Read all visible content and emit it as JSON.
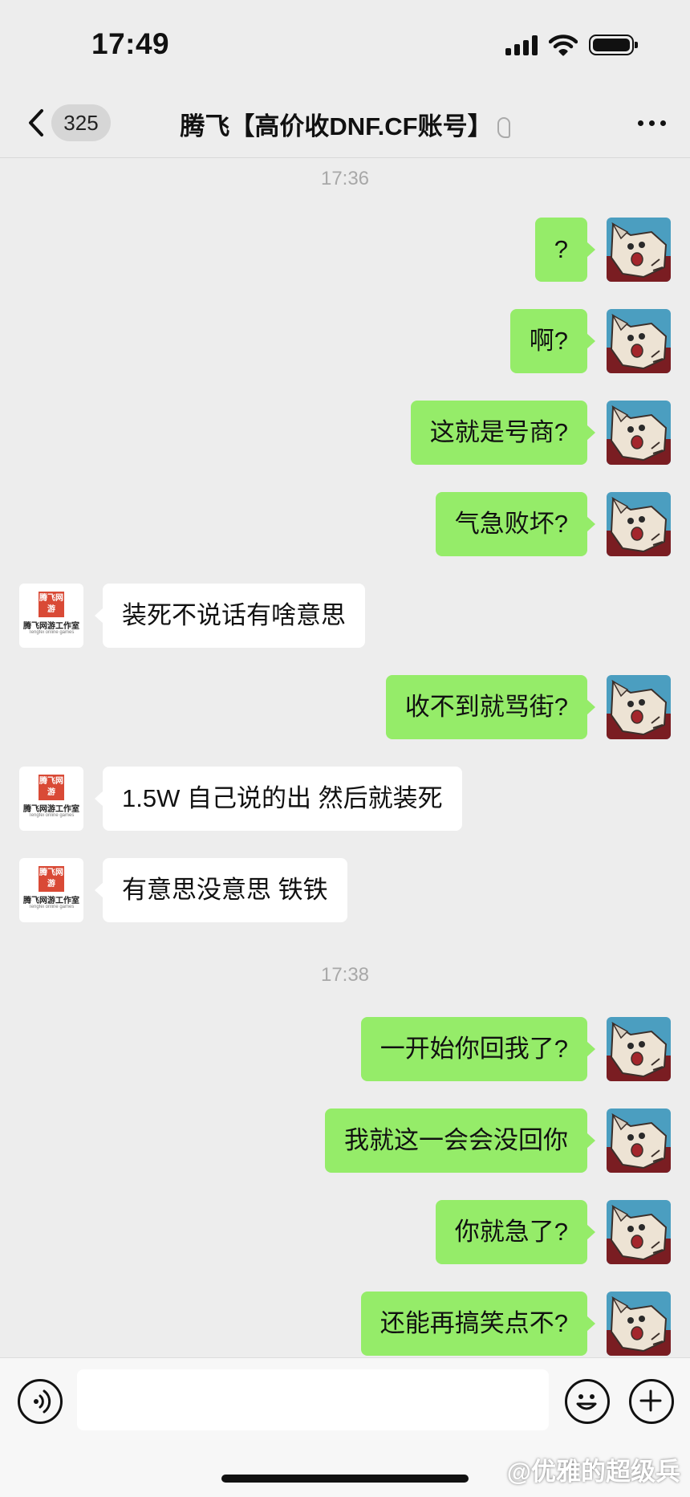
{
  "status_bar": {
    "time": "17:49"
  },
  "nav": {
    "unread_count": "325",
    "title": "腾飞【高价收DNF.CF账号】"
  },
  "contact_logo": {
    "badge_text": "腾飞网游",
    "name": "腾飞网游工作室",
    "subtitle": "Tengfei online games"
  },
  "colors": {
    "self_bubble": "#95ec69",
    "other_bubble": "#ffffff",
    "background": "#ededed"
  },
  "messages": [
    {
      "type": "timestamp",
      "text": "17:36"
    },
    {
      "type": "sent",
      "text": "?"
    },
    {
      "type": "sent",
      "text": "啊?"
    },
    {
      "type": "sent",
      "text": "这就是号商?"
    },
    {
      "type": "sent",
      "text": "气急败坏?"
    },
    {
      "type": "received",
      "text": "装死不说话有啥意思"
    },
    {
      "type": "sent",
      "text": "收不到就骂街?"
    },
    {
      "type": "received",
      "text": "1.5W 自己说的出 然后就装死"
    },
    {
      "type": "received",
      "text": "有意思没意思 铁铁"
    },
    {
      "type": "timestamp",
      "text": "17:38"
    },
    {
      "type": "sent",
      "text": "一开始你回我了?"
    },
    {
      "type": "sent",
      "text": "我就这一会会没回你"
    },
    {
      "type": "sent",
      "text": "你就急了?"
    },
    {
      "type": "sent",
      "text": "还能再搞笑点不?"
    }
  ],
  "input": {
    "value": "",
    "placeholder": ""
  },
  "watermark": "@优雅的超级兵",
  "icons": [
    "back-chevron-icon",
    "ear-icon",
    "more-icon",
    "voice-icon",
    "emoji-icon",
    "plus-icon",
    "signal-icon",
    "wifi-icon",
    "battery-icon"
  ]
}
